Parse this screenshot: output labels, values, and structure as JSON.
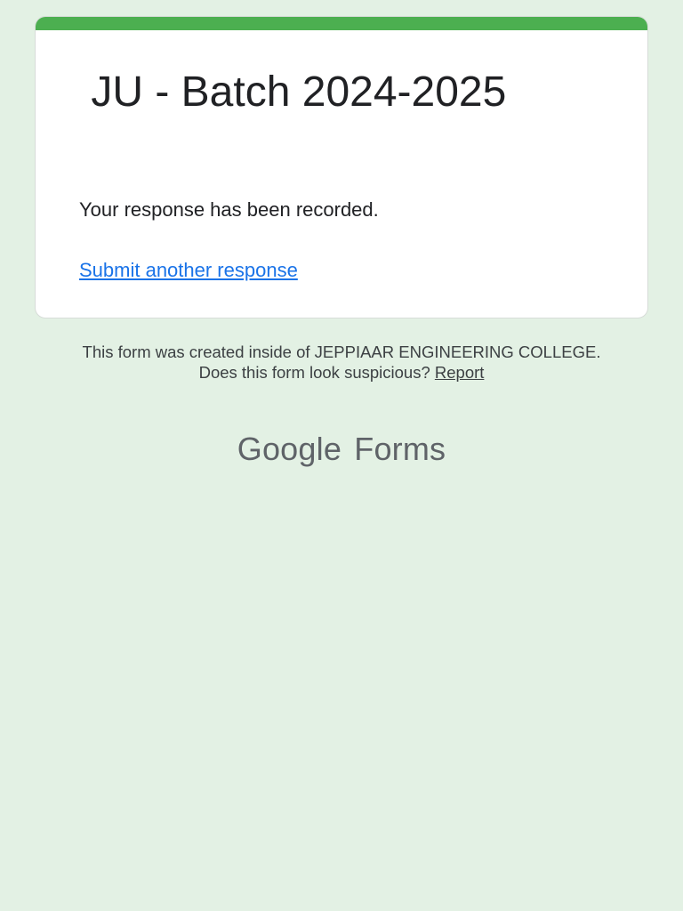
{
  "form": {
    "title": " JU - Batch 2024-2025",
    "confirmation_message": "Your response has been recorded.",
    "submit_another_link": "Submit another response",
    "accent_color": "#4caf50"
  },
  "footer": {
    "created_inside_text": "This form was created inside of JEPPIAAR ENGINEERING COLLEGE.",
    "suspicious_prefix": "Does this form look suspicious?",
    "report_link": "Report"
  },
  "brand": {
    "google": "Google",
    "forms": "Forms"
  }
}
